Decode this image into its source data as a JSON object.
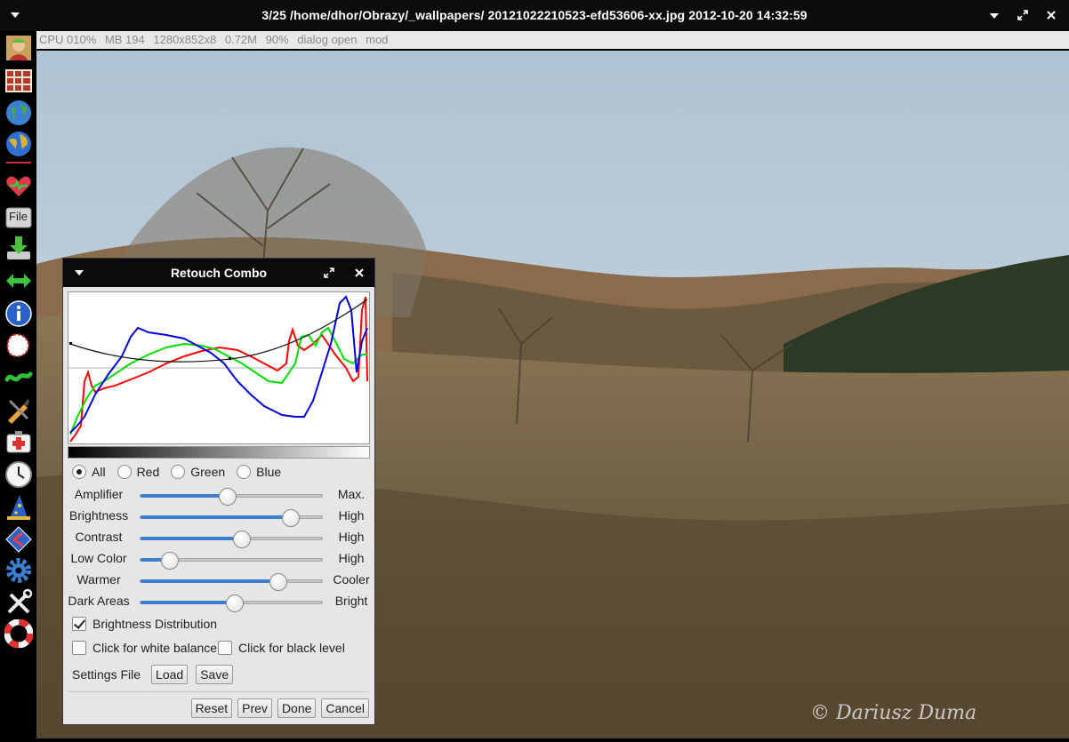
{
  "window": {
    "title": "3/25  /home/dhor/Obrazy/_wallpapers/  20121022210523-efd53606-xx.jpg  2012-10-20 14:32:59"
  },
  "status": {
    "items": [
      "CPU 010%",
      "MB 194",
      "1280x852x8",
      "0.72M",
      "90%",
      "dialog open",
      "mod"
    ]
  },
  "toolbar": {
    "icons": [
      "album-icon",
      "gallery-icon",
      "globe-icon",
      "world-map-icon",
      "favorites-heart-icon",
      "file-menu-icon",
      "save-download-icon",
      "resize-arrows-icon",
      "info-icon",
      "select-area-icon",
      "warp-icon",
      "edit-tools-icon",
      "repair-icon",
      "clock-icon",
      "wizard-icon",
      "prev-next-icon",
      "settings-gear-icon",
      "tools-icon",
      "help-lifebuoy-icon"
    ],
    "file_label": "File"
  },
  "dialog": {
    "title": "Retouch Combo",
    "channels": [
      {
        "label": "All",
        "selected": true
      },
      {
        "label": "Red",
        "selected": false
      },
      {
        "label": "Green",
        "selected": false
      },
      {
        "label": "Blue",
        "selected": false
      }
    ],
    "sliders": [
      {
        "label": "Amplifier",
        "high_label": "Max.",
        "value": 0.48
      },
      {
        "label": "Brightness",
        "high_label": "High",
        "value": 0.83
      },
      {
        "label": "Contrast",
        "high_label": "High",
        "value": 0.56
      },
      {
        "label": "Low Color",
        "high_label": "High",
        "value": 0.16
      },
      {
        "label": "Warmer",
        "high_label": "Cooler",
        "value": 0.76
      },
      {
        "label": "Dark Areas",
        "high_label": "Bright",
        "value": 0.52
      }
    ],
    "brightness_distribution": {
      "label": "Brightness Distribution",
      "checked": true
    },
    "white_balance": {
      "label": "Click for white balance",
      "checked": false
    },
    "black_level": {
      "label": "Click for black level",
      "checked": false
    },
    "settings_file_label": "Settings File",
    "load_label": "Load",
    "save_label": "Save",
    "reset_label": "Reset",
    "prev_label": "Prev",
    "done_label": "Done",
    "cancel_label": "Cancel"
  },
  "photo": {
    "watermark": "© Dariusz Duma"
  }
}
